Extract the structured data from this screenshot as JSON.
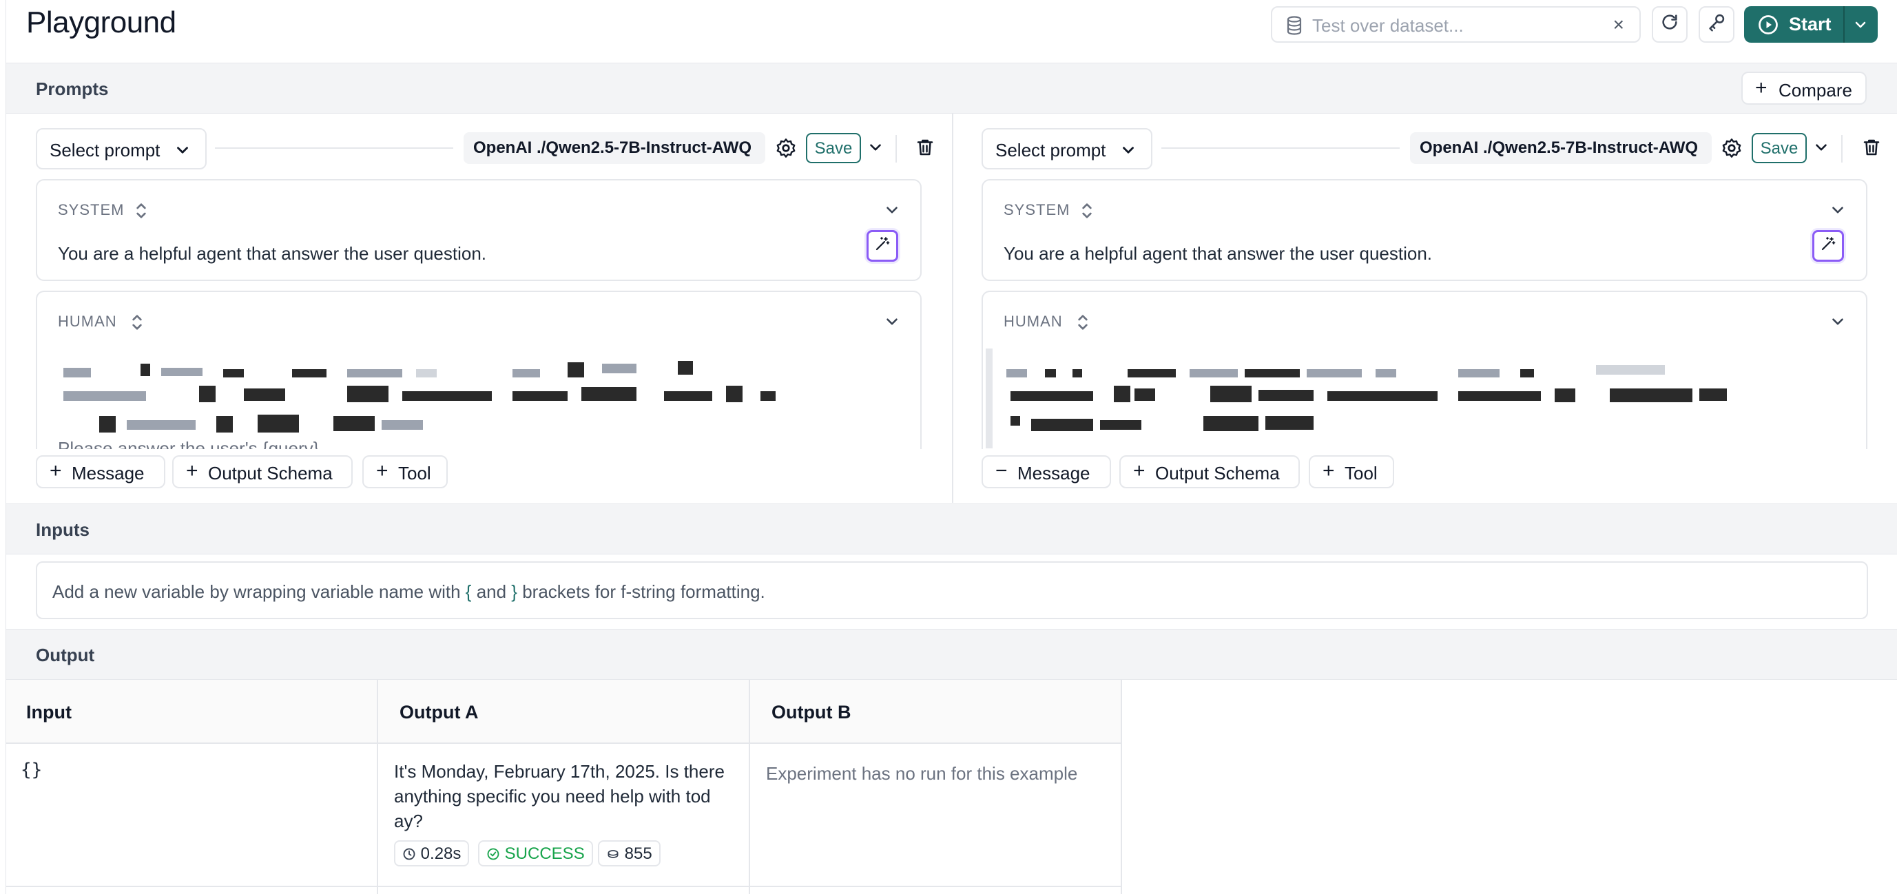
{
  "header": {
    "title": "Playground",
    "dataset_placeholder": "Test over dataset...",
    "clear_icon": "×",
    "start_label": "Start"
  },
  "prompts": {
    "section_label": "Prompts",
    "compare_label": "Compare",
    "columns": [
      {
        "select_label": "Select prompt",
        "model_provider": "OpenAI",
        "model_name": "./Qwen2.5-7B-Instruct-AWQ",
        "save_label": "Save",
        "system_role": "SYSTEM",
        "system_text": "You are a helpful agent that answer the user question.",
        "human_role": "HUMAN",
        "human_partial_text": "Please answer the user's {query}",
        "add_message": "Message",
        "add_schema": "Output Schema",
        "add_tool": "Tool"
      },
      {
        "select_label": "Select prompt",
        "model_provider": "OpenAI",
        "model_name": "./Qwen2.5-7B-Instruct-AWQ",
        "save_label": "Save",
        "system_role": "SYSTEM",
        "system_text": "You are a helpful agent that answer the user question.",
        "human_role": "HUMAN",
        "add_message": "Message",
        "add_schema": "Output Schema",
        "add_tool": "Tool"
      }
    ]
  },
  "inputs": {
    "section_label": "Inputs",
    "hint_before": "Add a new variable by wrapping variable name with ",
    "open_brace": "{",
    "hint_and": " and ",
    "close_brace": "}",
    "hint_after": " brackets for f-string formatting."
  },
  "output": {
    "section_label": "Output",
    "columns": [
      "Input",
      "Output A",
      "Output B"
    ],
    "rows": [
      {
        "input": "{}",
        "output_a_line1": "It's Monday, February 17th, 2025. Is there",
        "output_a_line2": "anything specific you need help with tod",
        "output_a_line3": "ay?",
        "latency": "0.28s",
        "status": "SUCCESS",
        "tokens": "855",
        "output_b": "Experiment has no run for this example"
      }
    ]
  },
  "colors": {
    "accent": "#1f6f6a",
    "success": "#16a34a",
    "wand_border": "#8b5cf6"
  }
}
